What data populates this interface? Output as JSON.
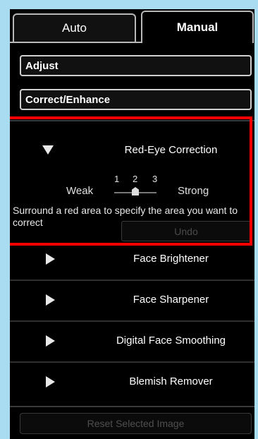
{
  "tabs": [
    {
      "label": "Auto"
    },
    {
      "label": "Manual"
    }
  ],
  "sections": {
    "adjust": "Adjust",
    "correct_enhance": "Correct/Enhance"
  },
  "red_eye": {
    "label": "Red-Eye Correction",
    "weak": "Weak",
    "strong": "Strong",
    "levels": [
      "1",
      "2",
      "3"
    ],
    "selected_level": 2,
    "hint": "Surround a red area to specify the area you want to correct",
    "undo": "Undo"
  },
  "items": [
    {
      "label": "Face Brightener"
    },
    {
      "label": "Face Sharpener"
    },
    {
      "label": "Digital Face Smoothing"
    },
    {
      "label": "Blemish Remover"
    }
  ],
  "reset_label": "Reset Selected Image",
  "colors": {
    "background": "#a9dcf0",
    "panel": "#000000",
    "highlight_frame": "#ff0000"
  }
}
